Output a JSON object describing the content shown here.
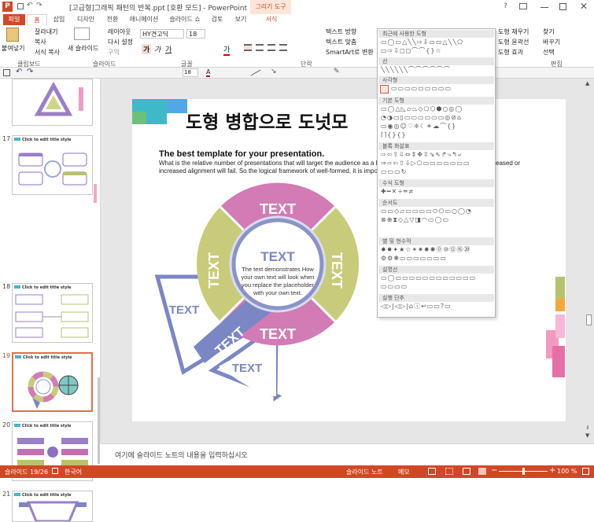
{
  "window": {
    "title": "[고급형]그래픽 패턴의 반복.ppt [호환 모드] - PowerPoint",
    "contextual": "그리기 도구",
    "help": "?"
  },
  "tabs": [
    "파일",
    "홈",
    "삽입",
    "디자인",
    "전환",
    "애니메이션",
    "슬라이드 쇼",
    "검토",
    "보기",
    "서식"
  ],
  "ribbon": {
    "paste": "붙여넣기",
    "cut": "잘라내기",
    "copy": "복사",
    "format_painter": "서식 복사",
    "new_slide": "새 슬라이드",
    "layout": "레이아웃",
    "reset": "다시 설정",
    "section": "구역",
    "font_name": "HY견고딕",
    "font_size": "18",
    "text_direction": "텍스트 방향",
    "align_text": "텍스트 맞춤",
    "smartart": "SmartArt로 변환",
    "arrange": "정렬",
    "quick_styles": "빠른 스타일",
    "shape_fill": "도형 채우기",
    "shape_outline": "도형 윤곽선",
    "shape_effects": "도형 효과",
    "find": "찾기",
    "replace": "바꾸기",
    "select": "선택",
    "groups": [
      "클립보드",
      "슬라이드",
      "글꼴",
      "단락",
      "편집"
    ]
  },
  "qat": {
    "font_size": "18"
  },
  "thumbs": [
    {
      "num": "",
      "title": ""
    },
    {
      "num": "17",
      "title": "Click to edit title style"
    },
    {
      "num": "18",
      "title": "Click to edit title style"
    },
    {
      "num": "19",
      "title": "Click to edit title style"
    },
    {
      "num": "20",
      "title": "Click to edit title style"
    },
    {
      "num": "21",
      "title": "Click to edit title style"
    }
  ],
  "slide": {
    "title": "도형 병합으로 도넛모",
    "subtitle": "The best template for your presentation.",
    "body1": "What is the relative number of presentations that will target the audience as a logic",
    "body1_tail": "eased or",
    "body2": "increased alignment will fail. So the logical framework of well-formed, it is importan",
    "segments": [
      "TEXT",
      "TEXT",
      "TEXT",
      "TEXT",
      "TEXT"
    ],
    "center_title": "TEXT",
    "center_body": [
      "The text demonstrates How",
      "your own text will look when",
      "you replace the placeholder",
      "with your own text."
    ],
    "outer_labels": [
      "TEXT",
      "TEXT",
      "TEXT"
    ]
  },
  "shapes_gallery": {
    "sections": [
      "최근에 사용한 도형",
      "선",
      "사각형",
      "기본 도형",
      "블록 화살표",
      "수식 도형",
      "순서도",
      "별 및 현수막",
      "설명선",
      "실행 단추"
    ],
    "rows": [
      [
        "▭◯▭△╲╲⇨⇩▭▭△╲╲⬠",
        "▭⇨⇩◻◻⌒⌒{}☆"
      ],
      [
        "╲╲╲╲╲╲⌒⌒⌒⌒⌒⌒"
      ],
      [
        "▭▭▭▭▭▭▭▭▭"
      ],
      [
        "▭◯△◺▱⏢◇⬠⬡⬢○◎◯",
        "◔◑▭▯▭▭▭▭▭▭◎⊘⌂",
        "▭◉◎☺♡❈☾☀☁⌒{}",
        "⌈⌉{}{}"
      ],
      [
        "⇨⇦⇧⇩⇔⇕✥⇳⇘⇖↱⤷↰⤶",
        "⇒⇨⇦⇧⇩▷⬠▭▭▭▭▭▭▭",
        "▭▭▭↻"
      ],
      [
        "✚━✕÷═≠"
      ],
      [
        "▭▭◇▱▭▭▭▭⬭⬠▭○◯◔",
        "⊗⊕⧗◇△▽◨◠▭◯▭"
      ],
      [
        "✸✸✦★☆✶✷✹✺⓪⑩⑫⑯⑳",
        "⚙⚙❋▭▭▭▭▭▭▭"
      ],
      [
        "▭◯▭▭▭▭▭▭▭▭▭▭▭▭",
        "▭▭▭▭"
      ],
      [
        "◁▷|◁▷|⌂ⓘ↩▭▭?▭"
      ]
    ]
  },
  "notes": "여기에 슬라이드 노트의 내용을 입력하십시오",
  "status": {
    "slide": "슬라이드 19/26",
    "lang": "한국어",
    "notes": "슬라이드 노트",
    "comments": "메모",
    "zoom": "100 %"
  }
}
